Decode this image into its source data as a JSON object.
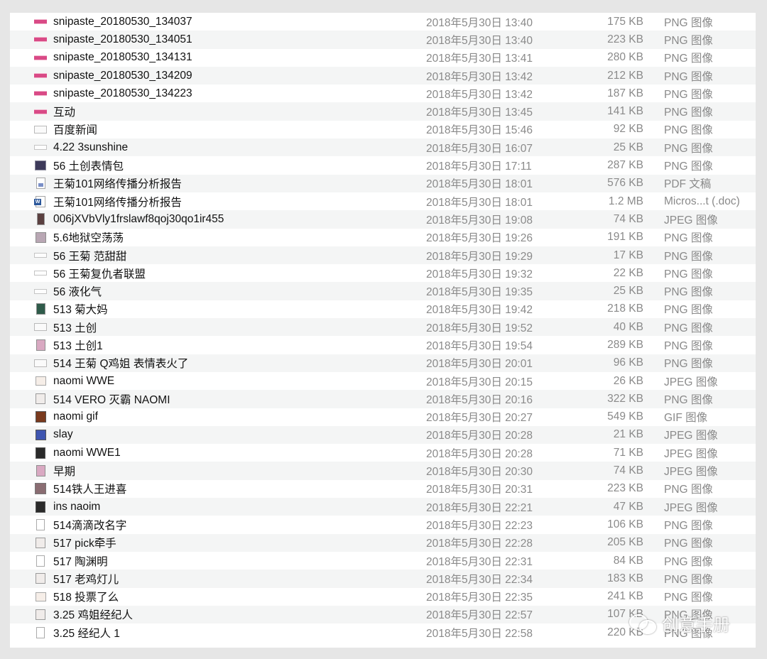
{
  "files": [
    {
      "name": "snipaste_20180530_134037",
      "date": "2018年5月30日 13:40",
      "size": "175 KB",
      "kind": "PNG 图像",
      "icon": "ic-strip"
    },
    {
      "name": "snipaste_20180530_134051",
      "date": "2018年5月30日 13:40",
      "size": "223 KB",
      "kind": "PNG 图像",
      "icon": "ic-strip"
    },
    {
      "name": "snipaste_20180530_134131",
      "date": "2018年5月30日 13:41",
      "size": "280 KB",
      "kind": "PNG 图像",
      "icon": "ic-strip"
    },
    {
      "name": "snipaste_20180530_134209",
      "date": "2018年5月30日 13:42",
      "size": "212 KB",
      "kind": "PNG 图像",
      "icon": "ic-strip"
    },
    {
      "name": "snipaste_20180530_134223",
      "date": "2018年5月30日 13:42",
      "size": "187 KB",
      "kind": "PNG 图像",
      "icon": "ic-strip"
    },
    {
      "name": "互动",
      "date": "2018年5月30日 13:45",
      "size": "141 KB",
      "kind": "PNG 图像",
      "icon": "ic-strip"
    },
    {
      "name": "百度新闻",
      "date": "2018年5月30日 15:46",
      "size": "92 KB",
      "kind": "PNG 图像",
      "icon": "ic-wide"
    },
    {
      "name": "4.22 3sunshine",
      "date": "2018年5月30日 16:07",
      "size": "25 KB",
      "kind": "PNG 图像",
      "icon": "ic-thin"
    },
    {
      "name": "56 土创表情包",
      "date": "2018年5月30日 17:11",
      "size": "287 KB",
      "kind": "PNG 图像",
      "icon": "ic-dark"
    },
    {
      "name": "王菊101网络传播分析报告",
      "date": "2018年5月30日 18:01",
      "size": "576 KB",
      "kind": "PDF 文稿",
      "icon": "ic-doc ic-pdf"
    },
    {
      "name": "王菊101网络传播分析报告",
      "date": "2018年5月30日 18:01",
      "size": "1.2 MB",
      "kind": "Micros...t (.doc)",
      "icon": "ic-word"
    },
    {
      "name": "006jXVbVly1frslawf8qoj30qo1ir455",
      "date": "2018年5月30日 19:08",
      "size": "74 KB",
      "kind": "JPEG 图像",
      "icon": "ic-tall"
    },
    {
      "name": "5.6地狱空荡荡",
      "date": "2018年5月30日 19:26",
      "size": "191 KB",
      "kind": "PNG 图像",
      "icon": "ic-photo"
    },
    {
      "name": "56 王菊 范甜甜",
      "date": "2018年5月30日 19:29",
      "size": "17 KB",
      "kind": "PNG 图像",
      "icon": "ic-thin"
    },
    {
      "name": "56 王菊复仇者联盟",
      "date": "2018年5月30日 19:32",
      "size": "22 KB",
      "kind": "PNG 图像",
      "icon": "ic-thin"
    },
    {
      "name": "56 液化气",
      "date": "2018年5月30日 19:35",
      "size": "25 KB",
      "kind": "PNG 图像",
      "icon": "ic-thin"
    },
    {
      "name": "513 菊大妈",
      "date": "2018年5月30日 19:42",
      "size": "218 KB",
      "kind": "PNG 图像",
      "icon": "ic-green"
    },
    {
      "name": "513 土创",
      "date": "2018年5月30日 19:52",
      "size": "40 KB",
      "kind": "PNG 图像",
      "icon": "ic-wide"
    },
    {
      "name": "513 土创1",
      "date": "2018年5月30日 19:54",
      "size": "289 KB",
      "kind": "PNG 图像",
      "icon": "ic-pink"
    },
    {
      "name": "514 王菊 Q鸡姐 表情表火了",
      "date": "2018年5月30日 20:01",
      "size": "96 KB",
      "kind": "PNG 图像",
      "icon": "ic-wide"
    },
    {
      "name": "naomi WWE",
      "date": "2018年5月30日 20:15",
      "size": "26 KB",
      "kind": "JPEG 图像",
      "icon": "ic-card"
    },
    {
      "name": "514 VERO 灭霸  NAOMI",
      "date": "2018年5月30日 20:16",
      "size": "322 KB",
      "kind": "PNG 图像",
      "icon": "ic-light"
    },
    {
      "name": "naomi gif",
      "date": "2018年5月30日 20:27",
      "size": "549 KB",
      "kind": "GIF 图像",
      "icon": "ic-gold"
    },
    {
      "name": "slay",
      "date": "2018年5月30日 20:28",
      "size": "21 KB",
      "kind": "JPEG 图像",
      "icon": "ic-blue"
    },
    {
      "name": "naomi WWE1",
      "date": "2018年5月30日 20:28",
      "size": "71 KB",
      "kind": "JPEG 图像",
      "icon": "ic-black"
    },
    {
      "name": "早期",
      "date": "2018年5月30日 20:30",
      "size": "74 KB",
      "kind": "JPEG 图像",
      "icon": "ic-pink"
    },
    {
      "name": "514铁人王进喜",
      "date": "2018年5月30日 20:31",
      "size": "223 KB",
      "kind": "PNG 图像",
      "icon": "ic-mid"
    },
    {
      "name": "ins naoim",
      "date": "2018年5月30日 22:21",
      "size": "47 KB",
      "kind": "JPEG 图像",
      "icon": "ic-black"
    },
    {
      "name": "514滴滴改名字",
      "date": "2018年5月30日 22:23",
      "size": "106 KB",
      "kind": "PNG 图像",
      "icon": "ic-page"
    },
    {
      "name": "517 pick牵手",
      "date": "2018年5月30日 22:28",
      "size": "205 KB",
      "kind": "PNG 图像",
      "icon": "ic-light"
    },
    {
      "name": "517 陶渊明",
      "date": "2018年5月30日 22:31",
      "size": "84 KB",
      "kind": "PNG 图像",
      "icon": "ic-page"
    },
    {
      "name": "517 老鸡灯儿",
      "date": "2018年5月30日 22:34",
      "size": "183 KB",
      "kind": "PNG 图像",
      "icon": "ic-light"
    },
    {
      "name": "518 投票了么",
      "date": "2018年5月30日 22:35",
      "size": "241 KB",
      "kind": "PNG 图像",
      "icon": "ic-card"
    },
    {
      "name": "3.25 鸡姐经纪人",
      "date": "2018年5月30日 22:57",
      "size": "107 KB",
      "kind": "PNG 图像",
      "icon": "ic-light"
    },
    {
      "name": "3.25 经纪人 1",
      "date": "2018年5月30日 22:58",
      "size": "220 KB",
      "kind": "PNG 图像",
      "icon": "ic-page"
    }
  ],
  "watermark": {
    "text": "创意手册"
  }
}
